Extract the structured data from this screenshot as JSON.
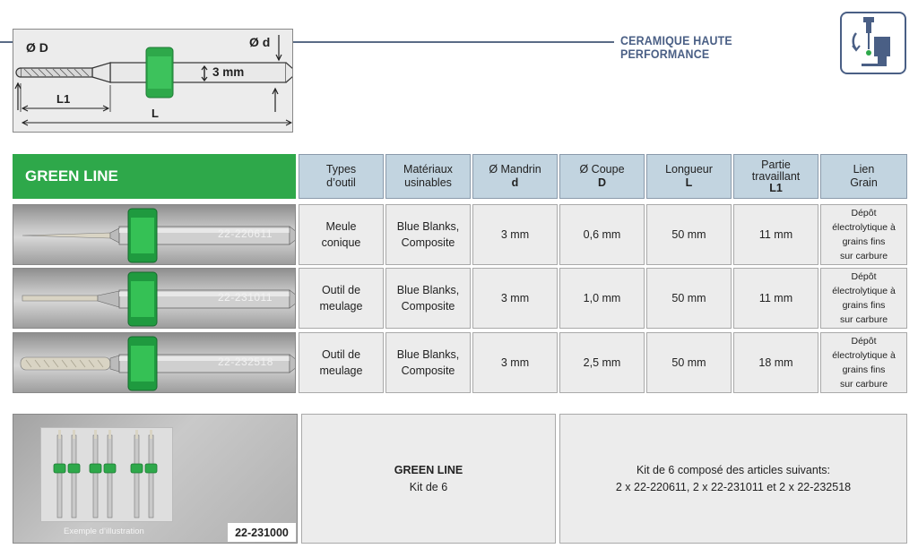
{
  "header": {
    "title": "CERAMIQUE HAUTE PERFORMANCE",
    "icon": "grinding-machine-icon",
    "accent_color": "#4a5f85"
  },
  "schematic": {
    "label_D": "Ø D",
    "label_d": "Ø d",
    "label_shank": "3 mm",
    "label_L1": "L1",
    "label_L": "L"
  },
  "table": {
    "section_title": "GREEN LINE",
    "section_color": "#2ea84a",
    "headers": [
      {
        "line1": "Types",
        "line2": "d’outil",
        "sub": ""
      },
      {
        "line1": "Matériaux",
        "line2": "usinables",
        "sub": ""
      },
      {
        "line1": "Ø Mandrin",
        "line2": "",
        "sub": "d"
      },
      {
        "line1": "Ø Coupe",
        "line2": "",
        "sub": "D"
      },
      {
        "line1": "Longueur",
        "line2": "",
        "sub": "L"
      },
      {
        "line1": "Partie",
        "line2": "travaillant",
        "sub": "L1"
      },
      {
        "line1": "Lien",
        "line2": "Grain",
        "sub": ""
      }
    ],
    "rows": [
      {
        "code": "22-220611",
        "type_line1": "Meule",
        "type_line2": "conique",
        "materials_line1": "Blue Blanks,",
        "materials_line2": "Composite",
        "shank": "3 mm",
        "cut": "0,6 mm",
        "length": "50 mm",
        "working": "11 mm",
        "bond_line1": "Dépôt",
        "bond_line2": "électrolytique à",
        "bond_line3": "grains fins",
        "bond_line4": "sur carbure"
      },
      {
        "code": "22-231011",
        "type_line1": "Outil de",
        "type_line2": "meulage",
        "materials_line1": "Blue Blanks,",
        "materials_line2": "Composite",
        "shank": "3 mm",
        "cut": "1,0 mm",
        "length": "50 mm",
        "working": "11 mm",
        "bond_line1": "Dépôt",
        "bond_line2": "électrolytique à",
        "bond_line3": "grains fins",
        "bond_line4": "sur carbure"
      },
      {
        "code": "22-232518",
        "type_line1": "Outil de",
        "type_line2": "meulage",
        "materials_line1": "Blue Blanks,",
        "materials_line2": "Composite",
        "shank": "3 mm",
        "cut": "2,5 mm",
        "length": "50 mm",
        "working": "18 mm",
        "bond_line1": "Dépôt",
        "bond_line2": "électrolytique à",
        "bond_line3": "grains fins",
        "bond_line4": "sur carbure"
      }
    ]
  },
  "kit": {
    "caption": "Exemple d’illustration",
    "code": "22-231000",
    "title": "GREEN LINE",
    "subtitle": "Kit de 6",
    "desc_line1": "Kit de 6 composé des articles suivants:",
    "desc_line2": "2 x 22-220611, 2 x 22-231011 et 2 x 22-232518"
  }
}
